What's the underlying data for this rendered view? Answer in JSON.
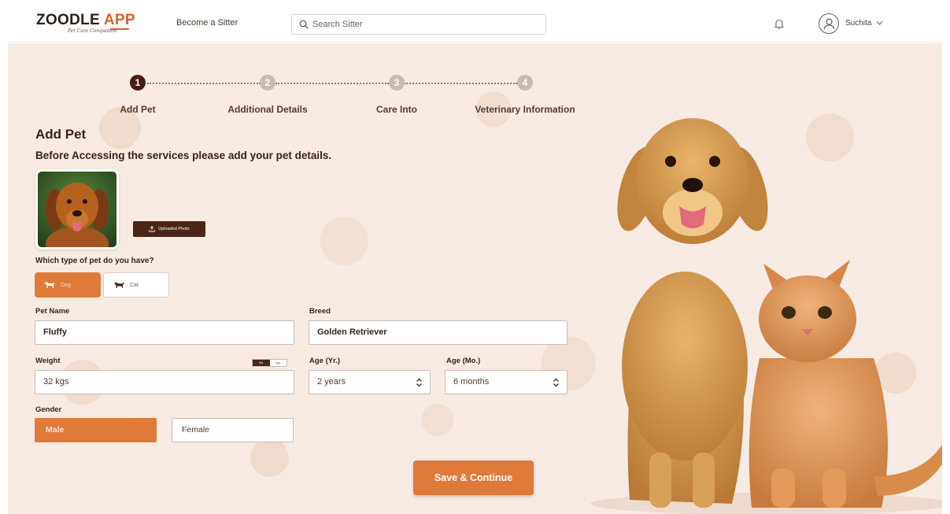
{
  "header": {
    "logo_main": "ZOODLE",
    "logo_app": "APP",
    "logo_tagline": "Pet Care Companion",
    "become_sitter": "Become a Sitter",
    "search_placeholder": "Search Sitter",
    "user_name": "Suchita"
  },
  "stepper": {
    "steps": [
      {
        "number": "1",
        "label": "Add Pet",
        "active": true
      },
      {
        "number": "2",
        "label": "Additional Details",
        "active": false
      },
      {
        "number": "3",
        "label": "Care Into",
        "active": false
      },
      {
        "number": "4",
        "label": "Veterinary Information",
        "active": false
      }
    ]
  },
  "form": {
    "title": "Add Pet",
    "subtitle": "Before Accessing the services please add your pet details.",
    "upload_label": "Uploaded Photo",
    "pet_type_question": "Which type of pet do you have?",
    "pet_types": [
      {
        "label": "Dog",
        "selected": true
      },
      {
        "label": "Cat",
        "selected": false
      }
    ],
    "pet_name_label": "Pet Name",
    "pet_name_value": "Fluffy",
    "breed_label": "Breed",
    "breed_value": "Golden Retriever",
    "weight_label": "Weight",
    "weight_value": "32 kgs",
    "weight_units": [
      "lbs",
      "kgs"
    ],
    "age_yr_label": "Age (Yr.)",
    "age_yr_value": "2 years",
    "age_mo_label": "Age (Mo.)",
    "age_mo_value": "6 months",
    "gender_label": "Gender",
    "gender_options": [
      {
        "label": "Male",
        "selected": true
      },
      {
        "label": "Female",
        "selected": false
      }
    ],
    "save_button": "Save & Continue"
  },
  "colors": {
    "accent": "#e07a3a",
    "dark_brown": "#4a1e12",
    "background": "#f7ebe3"
  }
}
